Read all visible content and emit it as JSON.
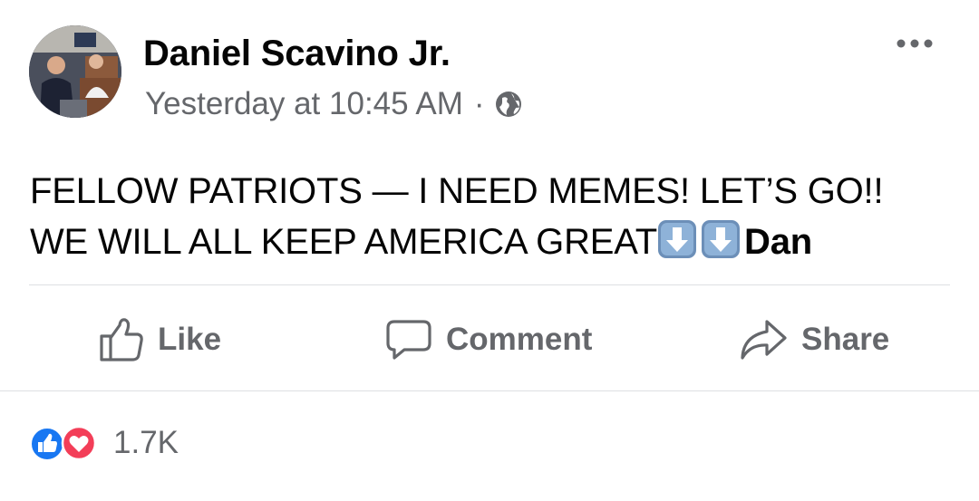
{
  "post": {
    "author": "Daniel Scavino Jr.",
    "timestamp": "Yesterday at 10:45 AM",
    "separator": "·",
    "privacy_icon": "globe-icon",
    "more_icon": "more-options-icon",
    "text_line1": "FELLOW PATRIOTS — I NEED MEMES! LET’S GO!!",
    "text_line2": "WE WILL ALL KEEP AMERICA GREAT",
    "emoji": [
      "down-arrow-emoji",
      "down-arrow-emoji"
    ],
    "signature": "Dan"
  },
  "actions": {
    "like_label": "Like",
    "comment_label": "Comment",
    "share_label": "Share"
  },
  "reactions": {
    "icons": [
      "like-reaction-icon",
      "love-reaction-icon"
    ],
    "count": "1.7K"
  },
  "colors": {
    "text": "#050505",
    "secondary": "#65676b",
    "like_blue": "#1877f2",
    "love_red": "#f33e58",
    "divider": "#dddfe2"
  }
}
